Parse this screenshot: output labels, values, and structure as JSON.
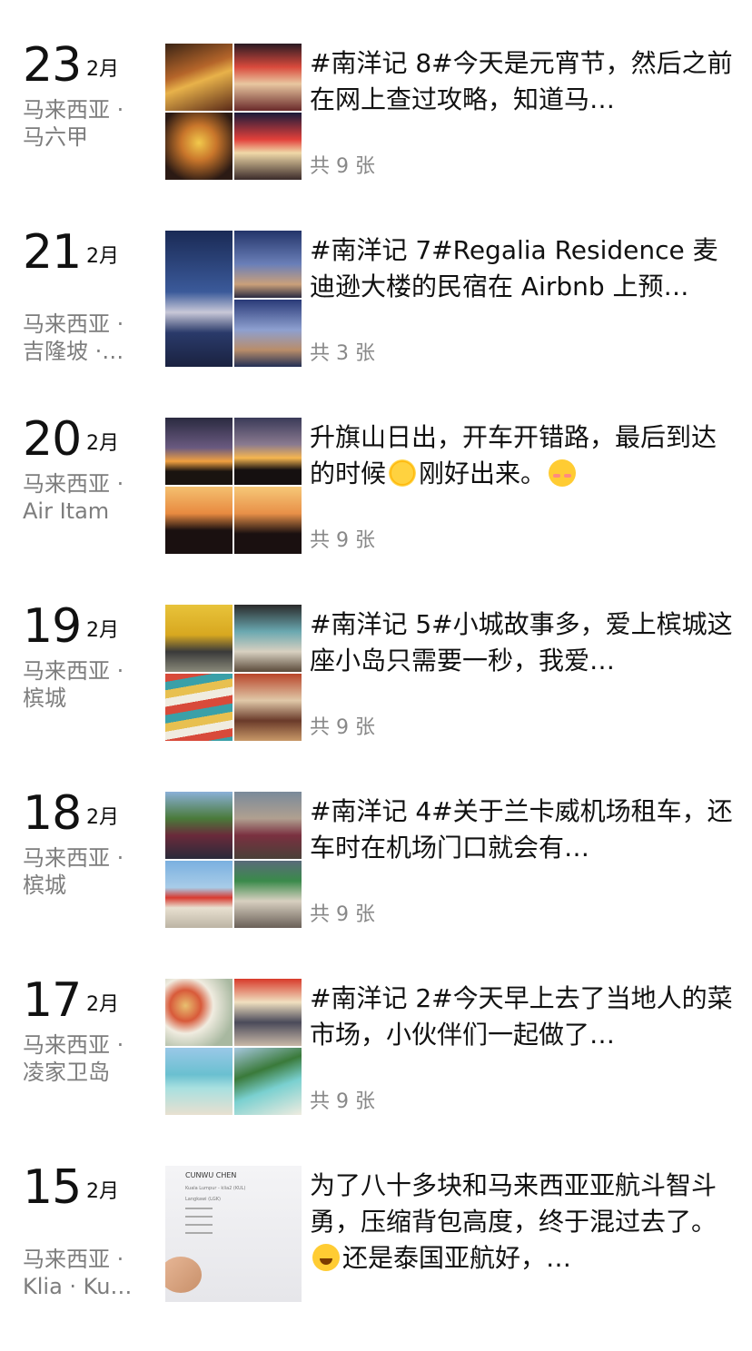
{
  "entries": [
    {
      "day": "23",
      "month": "2月",
      "location_line1": "马来西亚 ·",
      "location_line2": "马六甲",
      "text": "#南洋记 8#今天是元宵节，然后之前在网上查过攻略，知道马…",
      "count": "共 9 张",
      "layout": "four",
      "photos": [
        "lion-dance-stage-photo",
        "temple-lanterns-photo",
        "lion-dance-costume-photo",
        "festival-stage-photo"
      ]
    },
    {
      "day": "21",
      "month": "2月",
      "location_line1": "马来西亚 ·",
      "location_line2": "吉隆坡 ·…",
      "text": "#南洋记 7#Regalia Residence 麦迪逊大楼的民宿在 Airbnb 上预…",
      "count": "共 3 张",
      "layout": "three",
      "photos": [
        "night-skyline-pool-photo",
        "twin-towers-photo",
        "rooftop-pool-photo"
      ]
    },
    {
      "day": "20",
      "month": "2月",
      "location_line1": "马来西亚 ·",
      "location_line2": "Air Itam",
      "text_before": "升旗山日出，开车开错路，最后到达的时候",
      "text_middle": "刚好出来。",
      "count": "共 9 张",
      "layout": "four",
      "emoji": [
        "sun-emoji",
        "blush-emoji"
      ],
      "photos": [
        "sunrise-silhouette-photo",
        "sunrise-pose-photo",
        "group-silhouette-photo",
        "group-jump-photo"
      ]
    },
    {
      "day": "19",
      "month": "2月",
      "location_line1": "马来西亚 ·",
      "location_line2": "槟城",
      "text": "#南洋记 5#小城故事多，爱上槟城这座小岛只需要一秒，我爱…",
      "count": "共 9 张",
      "layout": "four",
      "photos": [
        "yellow-shop-photo",
        "street-mural-photo",
        "colorful-signs-photo",
        "cafe-storefront-photo"
      ]
    },
    {
      "day": "18",
      "month": "2月",
      "location_line1": "马来西亚 ·",
      "location_line2": "槟城",
      "text": "#南洋记 4#关于兰卡威机场租车，还车时在机场门口就会有…",
      "count": "共 9 张",
      "layout": "four",
      "photos": [
        "group-palm-trees-photo",
        "friends-street-photo",
        "airasia-plane-photo",
        "shophouse-street-photo"
      ]
    },
    {
      "day": "17",
      "month": "2月",
      "location_line1": "马来西亚 ·",
      "location_line2": "凌家卫岛",
      "text": "#南洋记 2#今天早上去了当地人的菜市场，小伙伴们一起做了…",
      "count": "共 9 张",
      "layout": "four",
      "photos": [
        "food-table-photo",
        "market-stall-photo",
        "beach-sea-photo",
        "island-coast-photo"
      ]
    },
    {
      "day": "15",
      "month": "2月",
      "location_line1": "马来西亚 ·",
      "location_line2": "Klia · Ku…",
      "text_before": "为了八十多块和马来西亚亚航斗智斗勇，压缩背包高度，终于混过去了。",
      "text_middle": "还是泰国亚航好，…",
      "layout": "single",
      "emoji": [
        "laugh-cry-emoji"
      ],
      "photos": [
        "boarding-pass-photo"
      ],
      "boarding_pass": {
        "name": "CUNWU CHEN",
        "route": "Kuala Lumpur - klia2 (KUL)",
        "dest": "Langkawi (LGK)"
      }
    }
  ],
  "colors": {
    "date": "#111111",
    "location": "#7d7d7d",
    "count": "#888888",
    "background": "#ffffff"
  }
}
